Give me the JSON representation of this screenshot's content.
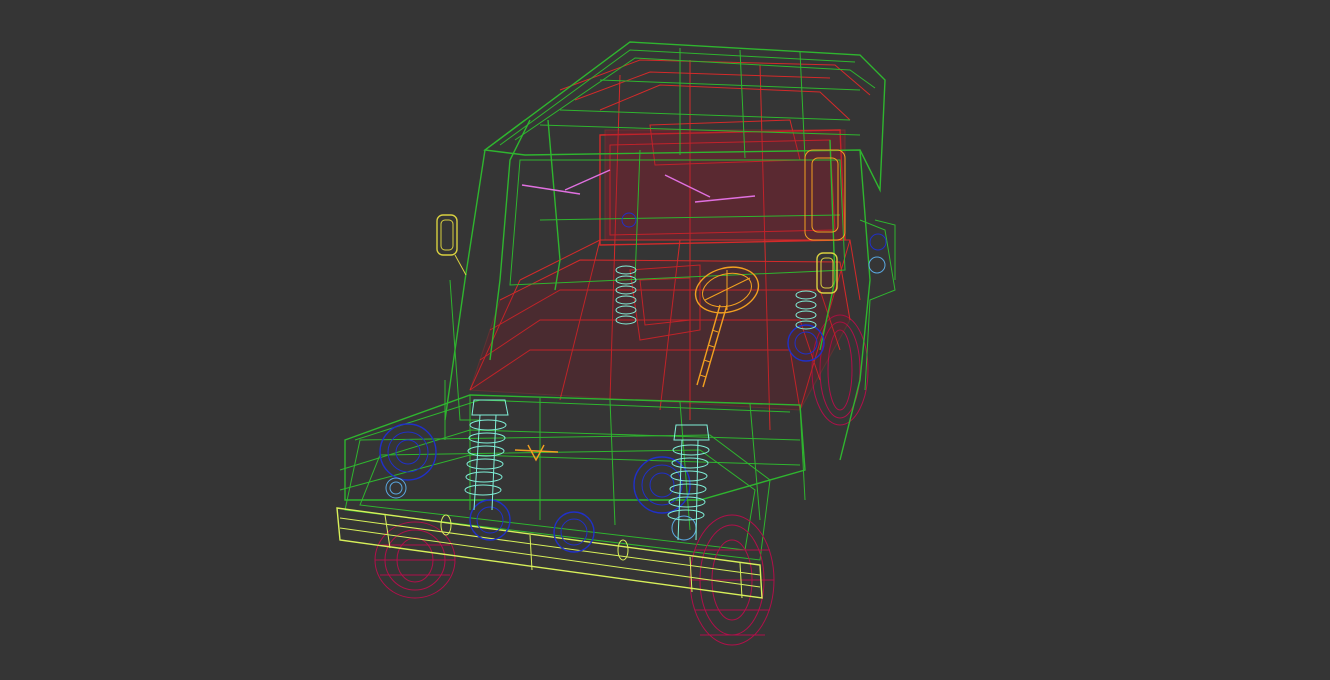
{
  "viewport": {
    "background": "#353535",
    "object": "vehicle-wireframe",
    "colors": {
      "body": "#2fb52f",
      "interior": "#d42a2a",
      "wheels": "#b0104a",
      "bumper": "#d8f05a",
      "springs": "#7ff0d8",
      "lamps": "#2030c8",
      "lamp_inner": "#5aa8e0",
      "steering": "#f2a020",
      "wipers": "#e070e0",
      "mirrors": "#d8d040"
    }
  }
}
